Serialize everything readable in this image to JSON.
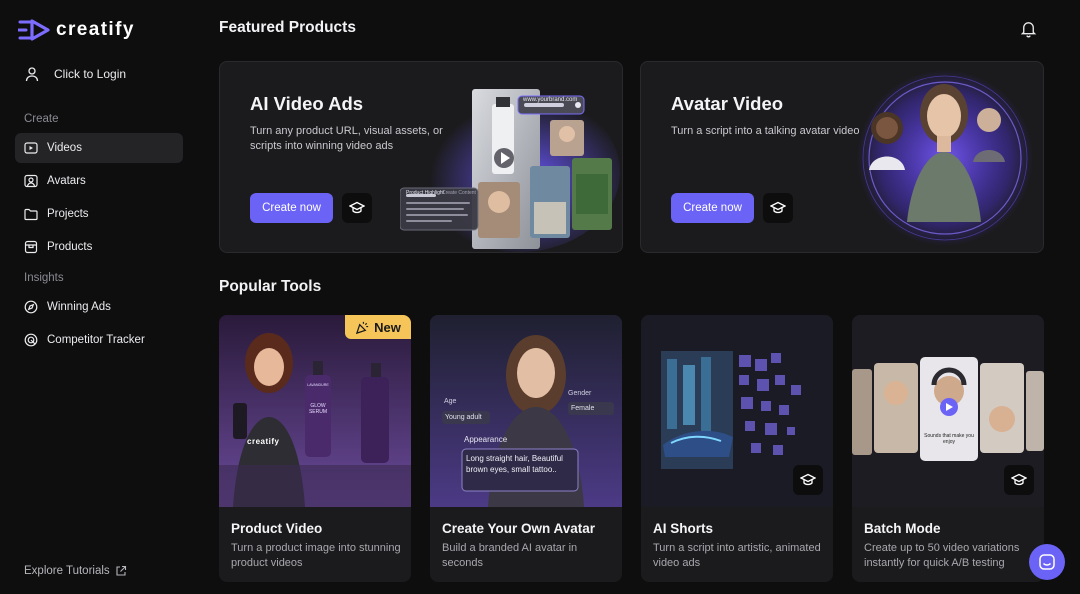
{
  "app": {
    "brand": "creatify",
    "accent": "#6b63f6"
  },
  "sidebar": {
    "login_label": "Click to Login",
    "create_label": "Create",
    "insights_label": "Insights",
    "items": [
      {
        "label": "Videos",
        "icon": "video-icon",
        "active": true
      },
      {
        "label": "Avatars",
        "icon": "avatar-icon"
      },
      {
        "label": "Projects",
        "icon": "folder-icon"
      },
      {
        "label": "Products",
        "icon": "product-box-icon"
      }
    ],
    "insight_items": [
      {
        "label": "Winning Ads",
        "icon": "compass-icon"
      },
      {
        "label": "Competitor Tracker",
        "icon": "radar-icon"
      }
    ],
    "explore_label": "Explore Tutorials"
  },
  "featured": {
    "title": "Featured Products",
    "cards": [
      {
        "title": "AI Video Ads",
        "description": "Turn any product URL, visual assets, or scripts into winning video ads",
        "button": "Create now",
        "url_chip": "www.yourbrand.com",
        "panel_title": "Product Highlight",
        "panel_tab": "Create Content"
      },
      {
        "title": "Avatar Video",
        "description": "Turn a script into a talking avatar video",
        "button": "Create now"
      }
    ]
  },
  "tools": {
    "title": "Popular Tools",
    "cards": [
      {
        "title": "Product Video",
        "description": "Turn a product image into stunning product videos",
        "badge": "New",
        "shirt_brand": "creatify",
        "bottle_brand": "LAVANDURE",
        "bottle_label": "GLOW SERUM"
      },
      {
        "title": "Create Your Own Avatar",
        "description": "Build a branded AI avatar in seconds",
        "age_label": "Age",
        "age_value": "Young adult",
        "gender_label": "Gender",
        "gender_value": "Female",
        "appearance_label": "Appearance",
        "appearance_text": "Long straight hair, Beautiful brown eyes, small tattoo.."
      },
      {
        "title": "AI Shorts",
        "description": "Turn a script into artistic, animated video ads"
      },
      {
        "title": "Batch Mode",
        "description": "Create up to 50 video variations instantly for quick A/B testing",
        "caption_1": "Sounds that make you enjoy"
      }
    ]
  }
}
